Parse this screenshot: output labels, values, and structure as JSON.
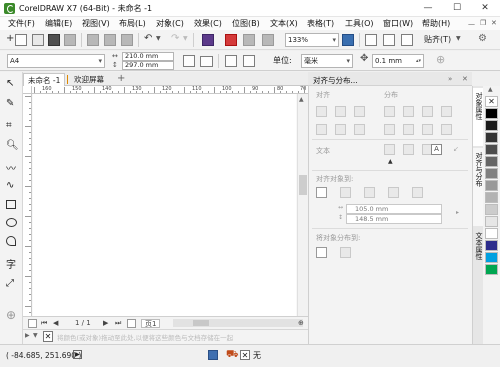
{
  "window": {
    "title": "CorelDRAW X7 (64-Bit) - 未命名 -1",
    "controls": {
      "minimize": "—",
      "maximize": "☐",
      "close": "✕"
    }
  },
  "menu": [
    "文件(F)",
    "编辑(E)",
    "视图(V)",
    "布局(L)",
    "对象(C)",
    "效果(C)",
    "位图(B)",
    "文本(X)",
    "表格(T)",
    "工具(O)",
    "窗口(W)",
    "帮助(H)"
  ],
  "toolbar": {
    "zoom_value": "133%",
    "snap_label": "贴齐(T)"
  },
  "propertybar": {
    "paper_size": "A4",
    "width": "210.0 mm",
    "height": "297.0 mm",
    "units_label": "单位:",
    "units_value": "毫米",
    "nudge_value": "0.1 mm"
  },
  "document_tabs": [
    "未命名 -1",
    "欢迎屏幕"
  ],
  "ruler": {
    "horizontal_labels": [
      "160",
      "150",
      "140",
      "130",
      "120",
      "110",
      "100",
      "90",
      "80",
      "70"
    ],
    "unit": "毫米"
  },
  "page_nav": {
    "current": "1 / 1",
    "page_tab": "页1"
  },
  "status": {
    "coords": "( -84.685, 251.690 )",
    "fill_label": "无",
    "hint": "将颜色(或对象)拖动至此处,以便将这些颜色与文档存储在一起"
  },
  "docker": {
    "title": "对齐与分布...",
    "sections": {
      "align": "对齐",
      "distribute": "分布",
      "text": "文本",
      "align_to": "对齐对象到:",
      "distribute_to": "将对象分布到:"
    },
    "x_value": "105.0 mm",
    "y_value": "148.5 mm"
  },
  "side_tabs": [
    "对象属性",
    "对齐与分布",
    "文本属性"
  ],
  "palette": {
    "colors": [
      "#ffffff",
      "#000000",
      "#1a1a1a",
      "#333333",
      "#4d4d4d",
      "#666666",
      "#808080",
      "#999999",
      "#b3b3b3",
      "#cccccc",
      "#e6e6e6",
      "#ffffff",
      "#2d2d8c",
      "#00a0e0",
      "#00a651"
    ]
  }
}
